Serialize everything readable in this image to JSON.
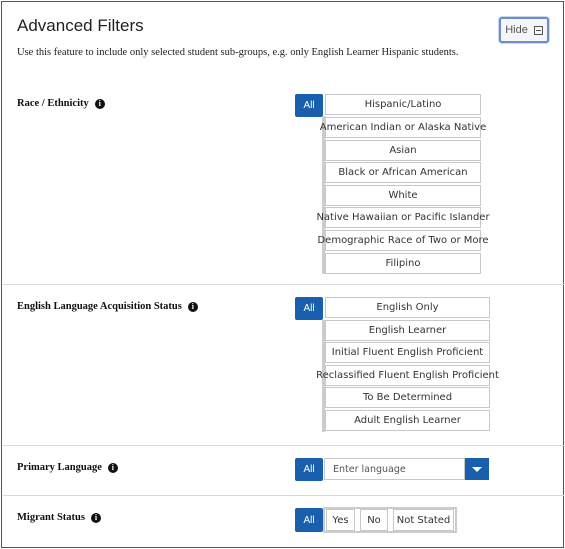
{
  "header": {
    "title": "Advanced Filters",
    "hide_label": "Hide",
    "description": "Use this feature to include only selected student sub-groups, e.g. only English Learner Hispanic students."
  },
  "sections": {
    "race": {
      "label": "Race / Ethnicity",
      "all_label": "All",
      "options": [
        "Hispanic/Latino",
        "American Indian or Alaska Native",
        "Asian",
        "Black or African American",
        "White",
        "Native Hawaiian or Pacific Islander",
        "Demographic Race of Two or More",
        "Filipino"
      ]
    },
    "ela": {
      "label": "English Language Acquisition Status",
      "all_label": "All",
      "options": [
        "English Only",
        "English Learner",
        "Initial Fluent English Proficient",
        "Reclassified Fluent English Proficient",
        "To Be Determined",
        "Adult English Learner"
      ]
    },
    "language": {
      "label": "Primary Language",
      "all_label": "All",
      "placeholder": "Enter language"
    },
    "migrant": {
      "label": "Migrant Status",
      "all_label": "All",
      "options": [
        "Yes",
        "No",
        "Not Stated"
      ]
    }
  },
  "icons": {
    "info": "info-icon",
    "hide": "collapse-icon",
    "dropdown": "chevron-down-icon"
  },
  "colors": {
    "accent": "#1a5fad",
    "border": "#c8c8c8"
  }
}
